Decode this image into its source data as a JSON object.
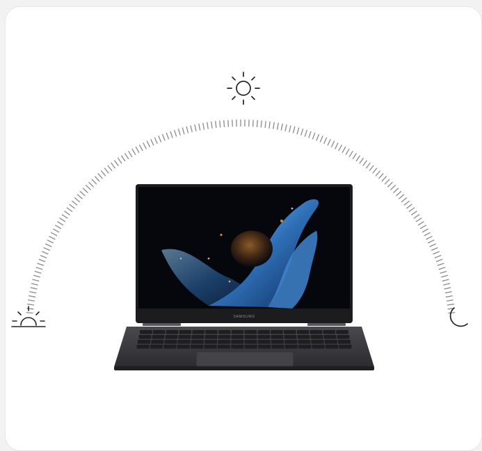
{
  "card": {
    "background": "#ffffff",
    "border": "#e6e6e6"
  },
  "icons": {
    "sunrise": "sunrise-icon",
    "sun": "sun-icon",
    "moon": "moon-icon"
  },
  "arc": {
    "style": "dashed-tick-arc",
    "color": "#8a8a8a"
  },
  "laptop": {
    "brand": "SAMSUNG",
    "body_color": "#3a3a3d",
    "screen_color": "#05070d",
    "wallpaper_accent": "#2f6fb6"
  }
}
